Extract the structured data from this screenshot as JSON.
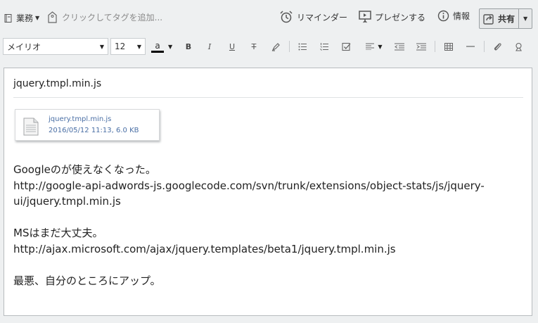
{
  "topbar": {
    "notebook_label": "業務",
    "tag_placeholder": "クリックしてタグを追加...",
    "reminder_label": "リマインダー",
    "present_label": "プレゼンする",
    "info_label": "情報",
    "share_label": "共有"
  },
  "format": {
    "font_family_value": "メイリオ",
    "font_size_value": "12",
    "text_color_letter": "a",
    "text_color": "#000000"
  },
  "note": {
    "title": "jquery.tmpl.min.js",
    "attachment": {
      "name": "jquery.tmpl.min.js",
      "meta": "2016/05/12 11:13, 6.0 KB"
    },
    "lines": [
      "Googleのが使えなくなった。",
      "http://google-api-adwords-js.googlecode.com/svn/trunk/extensions/object-stats/js/jquery-",
      "ui/jquery.tmpl.min.js",
      "",
      "MSはまだ大丈夫。",
      "http://ajax.microsoft.com/ajax/jquery.templates/beta1/jquery.tmpl.min.js",
      "",
      "最悪、自分のところにアップ。"
    ]
  },
  "colors": {
    "app_background": "#eef0f1",
    "attachment_link": "#4a6fa5"
  }
}
